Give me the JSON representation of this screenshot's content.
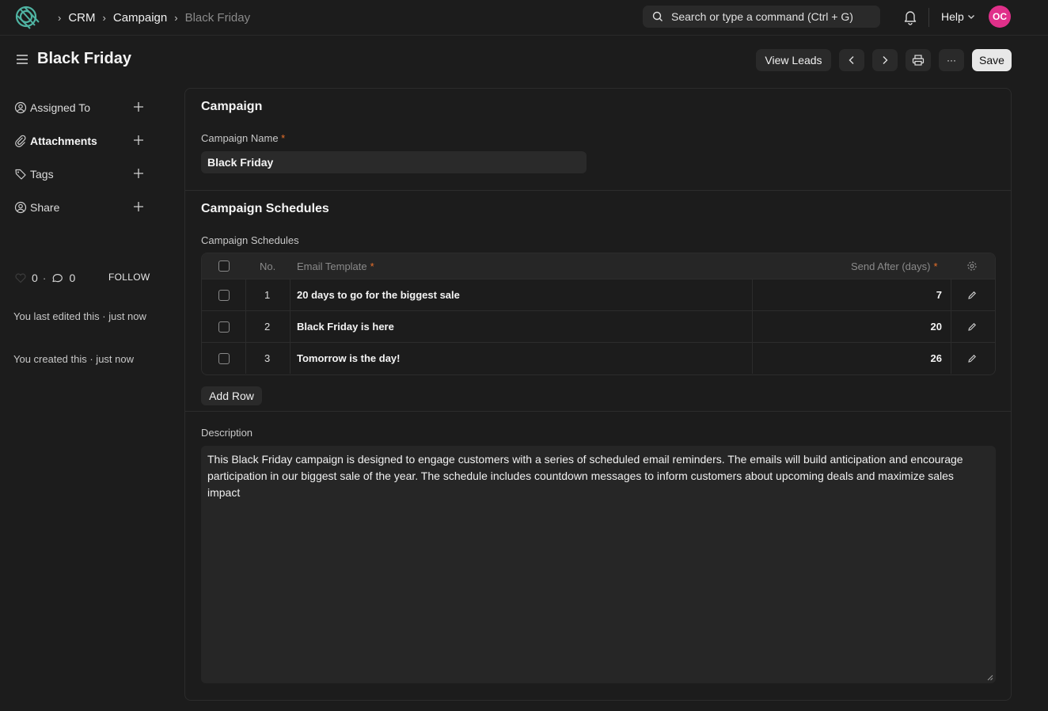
{
  "navbar": {
    "breadcrumbs": [
      "CRM",
      "Campaign",
      "Black Friday"
    ],
    "search_placeholder": "Search or type a command (Ctrl + G)",
    "help_label": "Help",
    "avatar_initials": "OC",
    "avatar_color": "#e0308a"
  },
  "header": {
    "title": "Black Friday",
    "view_leads_label": "View Leads",
    "more_label": "···",
    "save_label": "Save"
  },
  "sidebar": {
    "items": [
      {
        "label": "Assigned To",
        "icon": "user-circle-icon"
      },
      {
        "label": "Attachments",
        "icon": "paperclip-icon"
      },
      {
        "label": "Tags",
        "icon": "tag-icon"
      },
      {
        "label": "Share",
        "icon": "share-user-icon"
      }
    ],
    "likes_count": "0",
    "comments_count": "0",
    "follow_label": "FOLLOW",
    "last_edited": "You last edited this · just now",
    "created": "You created this · just now"
  },
  "form": {
    "section_campaign": "Campaign",
    "campaign_name_label": "Campaign Name",
    "required_mark": "*",
    "campaign_name_value": "Black Friday",
    "section_schedules": "Campaign Schedules",
    "schedules_table_label": "Campaign Schedules",
    "table": {
      "col_no": "No.",
      "col_template": "Email Template",
      "col_days": "Send After (days)",
      "rows": [
        {
          "no": "1",
          "template": "20 days to go for the biggest sale",
          "days": "7"
        },
        {
          "no": "2",
          "template": "Black Friday is here",
          "days": "20"
        },
        {
          "no": "3",
          "template": "Tomorrow is the day!",
          "days": "26"
        }
      ]
    },
    "add_row_label": "Add Row",
    "description_label": "Description",
    "description_value": "This Black Friday campaign is designed to engage customers with a series of scheduled email reminders. The emails will build anticipation and encourage participation in our biggest sale of the year. The schedule includes countdown messages to inform customers about upcoming deals and maximize sales impact"
  },
  "colors": {
    "background": "#1c1c1c",
    "accent_required": "#e8702a",
    "logo": "#4fb3a2"
  }
}
